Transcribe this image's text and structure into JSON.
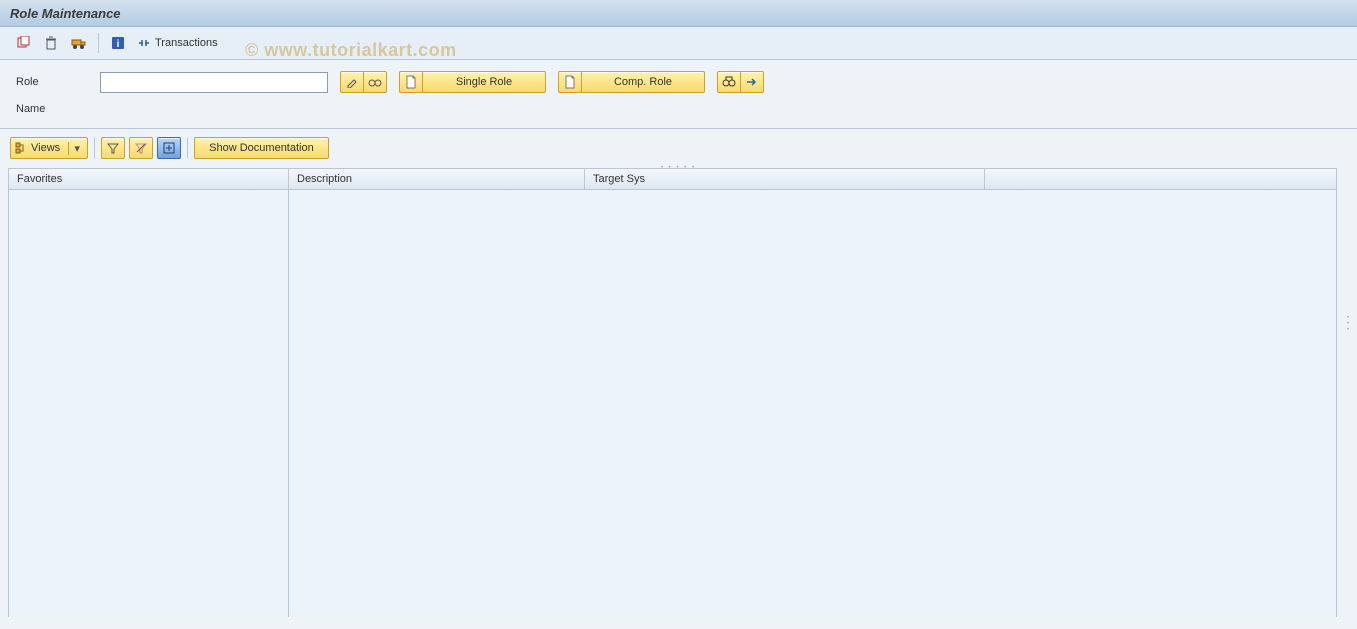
{
  "title": "Role Maintenance",
  "watermark": "© www.tutorialkart.com",
  "toolbar": {
    "transactions_label": "Transactions"
  },
  "form": {
    "role_label": "Role",
    "role_value": "",
    "name_label": "Name",
    "single_role_label": "Single Role",
    "comp_role_label": "Comp. Role"
  },
  "secondary": {
    "views_label": "Views",
    "show_doc_label": "Show Documentation"
  },
  "grid": {
    "columns": {
      "favorites": "Favorites",
      "description": "Description",
      "target": "Target Sys"
    }
  }
}
